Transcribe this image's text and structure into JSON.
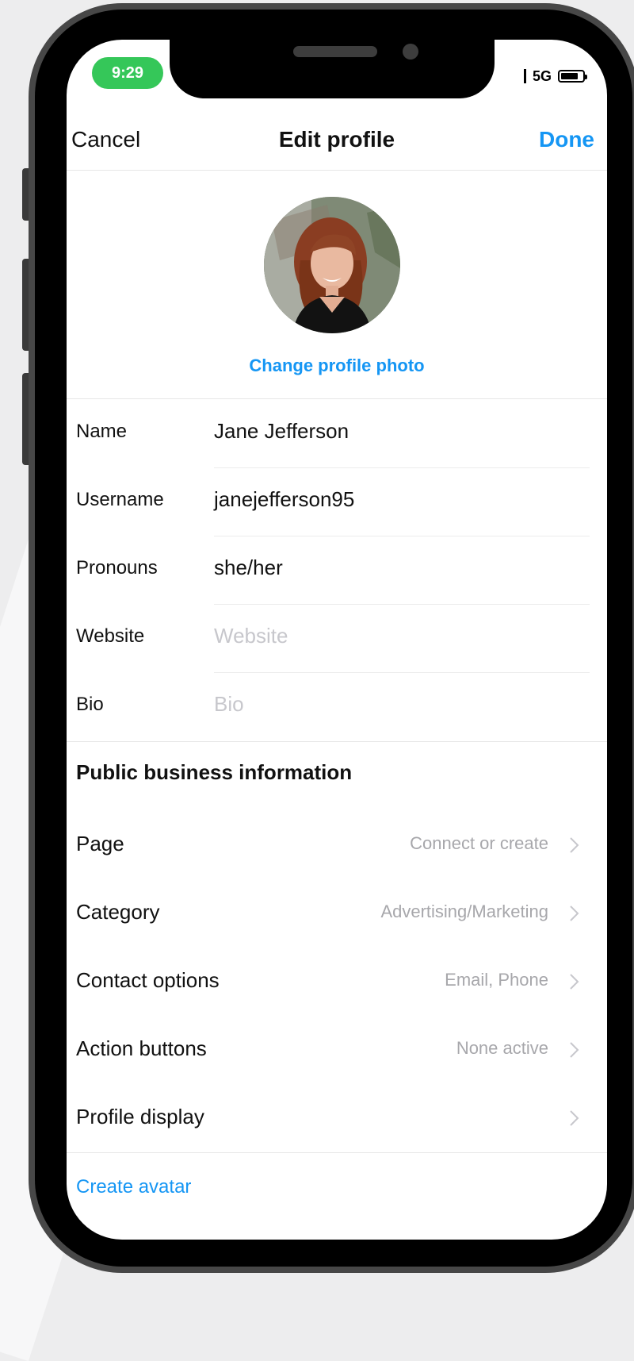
{
  "status_bar": {
    "time": "9:29",
    "network": "5G",
    "battery_level": 0.8
  },
  "nav": {
    "cancel": "Cancel",
    "title": "Edit profile",
    "done": "Done"
  },
  "profile": {
    "change_photo": "Change profile photo"
  },
  "fields": [
    {
      "label": "Name",
      "value": "Jane Jefferson",
      "placeholder": ""
    },
    {
      "label": "Username",
      "value": "janejefferson95",
      "placeholder": ""
    },
    {
      "label": "Pronouns",
      "value": "she/her",
      "placeholder": ""
    },
    {
      "label": "Website",
      "value": "",
      "placeholder": "Website"
    },
    {
      "label": "Bio",
      "value": "",
      "placeholder": "Bio"
    }
  ],
  "business": {
    "header": "Public business information",
    "rows": [
      {
        "label": "Page",
        "value": "Connect or create"
      },
      {
        "label": "Category",
        "value": "Advertising/Marketing"
      },
      {
        "label": "Contact options",
        "value": "Email, Phone"
      },
      {
        "label": "Action buttons",
        "value": "None active"
      },
      {
        "label": "Profile display",
        "value": ""
      }
    ]
  },
  "footer": {
    "create_avatar": "Create avatar"
  },
  "colors": {
    "accent": "#1596f4",
    "status_pill": "#35c759",
    "placeholder": "#c7c7cc",
    "secondary_text": "#a7a7ab"
  },
  "icons": {
    "chevron": "chevron-right-icon",
    "battery": "battery-icon",
    "avatar": "profile-photo"
  }
}
